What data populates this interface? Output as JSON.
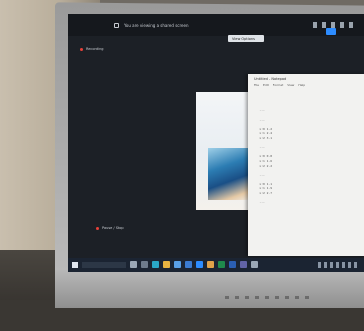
{
  "screen": {
    "meeting_bar_text": "You are viewing a shared screen",
    "pill_text": "View Options",
    "recording_label_top": "Recording",
    "recording_label_bottom": "Pause / Stop"
  },
  "notepad": {
    "title": "Untitled - Notepad",
    "menu": "File Edit Format View Help",
    "lines": "\n\n\n\n   ---\n\n   ---\n\n   x:0 1.2\n   x:1 2.4\n   x:2 3.1\n\n   ---\n\n   x:0 0.8\n   x:1 1.6\n   x:2 2.2\n\n   ---\n\n   x:0 1.1\n   x:1 1.9\n   x:2 2.7\n\n   ---"
  },
  "taskbar": {
    "icons": [
      "search-icon",
      "task-view-icon",
      "edge-icon",
      "explorer-icon",
      "store-icon",
      "mail-icon",
      "zoom-icon",
      "chrome-icon",
      "excel-icon",
      "word-icon",
      "teams-icon",
      "settings-icon"
    ],
    "icon_colors": [
      "#9aa6b5",
      "#6e7b8c",
      "#2aa7c6",
      "#e7b341",
      "#5aa0e6",
      "#3b7bd1",
      "#2d8cff",
      "#e0a24a",
      "#1f8a4c",
      "#2b5fb3",
      "#6264a7",
      "#9aa6b5"
    ]
  }
}
